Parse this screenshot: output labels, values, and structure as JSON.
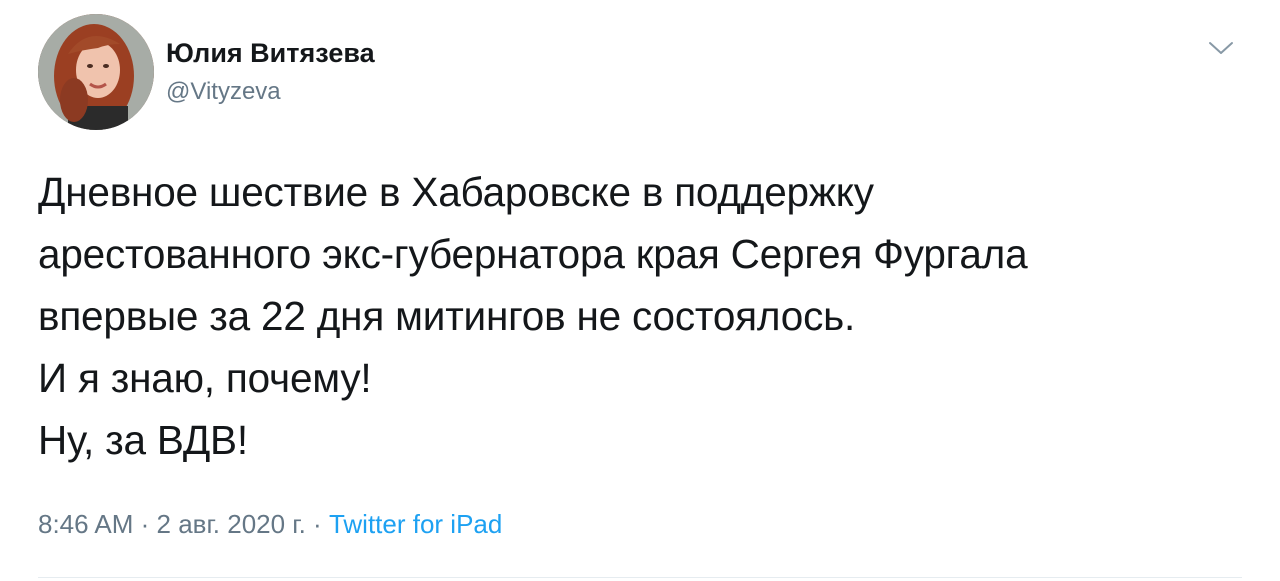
{
  "author": {
    "display_name": "Юлия Витязева",
    "handle": "@Vityzeva"
  },
  "tweet": {
    "lines": [
      "Дневное шествие в Хабаровске в поддержку",
      "арестованного экс-губернатора края Сергея Фургала",
      "впервые за 22 дня митингов не состоялось.",
      "И я знаю, почему!",
      "Ну, за ВДВ!"
    ]
  },
  "meta": {
    "time": "8:46 AM",
    "separator": " · ",
    "date": "2 авг. 2020 г.",
    "source": "Twitter for iPad"
  },
  "icons": {
    "menu": "chevron-down-icon"
  },
  "colors": {
    "text": "#14171a",
    "secondary": "#657786",
    "link": "#1da1f2"
  }
}
